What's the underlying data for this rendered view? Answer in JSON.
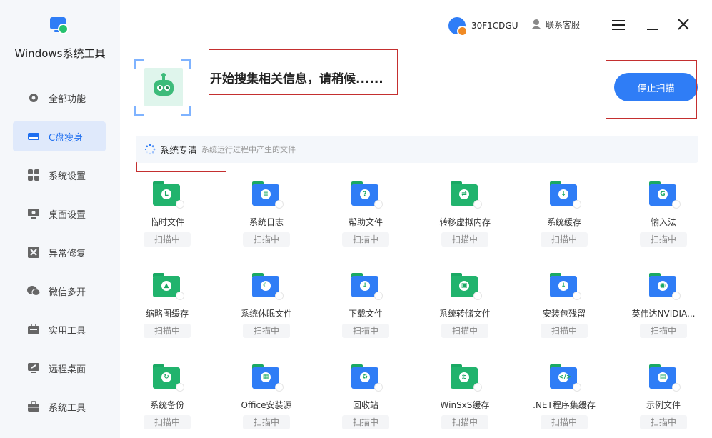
{
  "app": {
    "title": "Windows系统工具"
  },
  "colors": {
    "accent": "#2f7df6",
    "green": "#21b36d",
    "annotation": "#c42f2f"
  },
  "sidebar": {
    "items": [
      {
        "label": "全部功能",
        "icon": "gear-icon",
        "active": false
      },
      {
        "label": "C盘瘦身",
        "icon": "disk-icon",
        "active": true
      },
      {
        "label": "系统设置",
        "icon": "grid-icon",
        "active": false
      },
      {
        "label": "桌面设置",
        "icon": "monitor-gear-icon",
        "active": false
      },
      {
        "label": "异常修复",
        "icon": "wrench-icon",
        "active": false
      },
      {
        "label": "微信多开",
        "icon": "wechat-icon",
        "active": false
      },
      {
        "label": "实用工具",
        "icon": "toolbox-icon",
        "active": false
      },
      {
        "label": "远程桌面",
        "icon": "remote-icon",
        "active": false
      },
      {
        "label": "系统工具",
        "icon": "briefcase-icon",
        "active": false
      }
    ]
  },
  "topbar": {
    "user_id": "30F1CDGU",
    "service_label": "联系客服"
  },
  "scan": {
    "headline": "开始搜集相关信息，请稍候......",
    "stop_label": "停止扫描"
  },
  "section": {
    "title": "系统专清",
    "desc": "系统运行过程中产生的文件"
  },
  "tiles": [
    {
      "label": "临时文件",
      "status": "扫描中",
      "glyph": "L",
      "icon": "temp-files-icon"
    },
    {
      "label": "系统日志",
      "status": "扫描中",
      "glyph": "≡",
      "icon": "system-log-icon"
    },
    {
      "label": "帮助文件",
      "status": "扫描中",
      "glyph": "?",
      "icon": "help-files-icon"
    },
    {
      "label": "转移虚拟内存",
      "status": "扫描中",
      "glyph": "⇄",
      "icon": "chip-icon"
    },
    {
      "label": "系统缓存",
      "status": "扫描中",
      "glyph": "↓",
      "icon": "system-cache-icon"
    },
    {
      "label": "输入法",
      "status": "扫描中",
      "glyph": "G",
      "icon": "input-method-icon"
    },
    {
      "label": "缩略图缓存",
      "status": "扫描中",
      "glyph": "▲",
      "icon": "thumbnail-cache-icon"
    },
    {
      "label": "系统休眠文件",
      "status": "扫描中",
      "glyph": "☾",
      "icon": "hibernate-file-icon"
    },
    {
      "label": "下载文件",
      "status": "扫描中",
      "glyph": "↓",
      "icon": "download-files-icon"
    },
    {
      "label": "系统转储文件",
      "status": "扫描中",
      "glyph": "▣",
      "icon": "dump-file-icon"
    },
    {
      "label": "安装包残留",
      "status": "扫描中",
      "glyph": "↓",
      "icon": "installer-residue-icon"
    },
    {
      "label": "英伟达NVIDIA...",
      "status": "扫描中",
      "glyph": "◉",
      "icon": "nvidia-icon"
    },
    {
      "label": "系统备份",
      "status": "扫描中",
      "glyph": "↻",
      "icon": "system-backup-icon"
    },
    {
      "label": "Office安装源",
      "status": "扫描中",
      "glyph": "▦",
      "icon": "office-source-icon"
    },
    {
      "label": "回收站",
      "status": "扫描中",
      "glyph": "♻",
      "icon": "recycle-bin-icon"
    },
    {
      "label": "WinSxS缓存",
      "status": "扫描中",
      "glyph": "≋",
      "icon": "winsxs-icon"
    },
    {
      "label": ".NET程序集缓存",
      "status": "扫描中",
      "glyph": "</>",
      "icon": "dotnet-cache-icon"
    },
    {
      "label": "示例文件",
      "status": "扫描中",
      "glyph": "▤",
      "icon": "sample-files-icon"
    }
  ]
}
